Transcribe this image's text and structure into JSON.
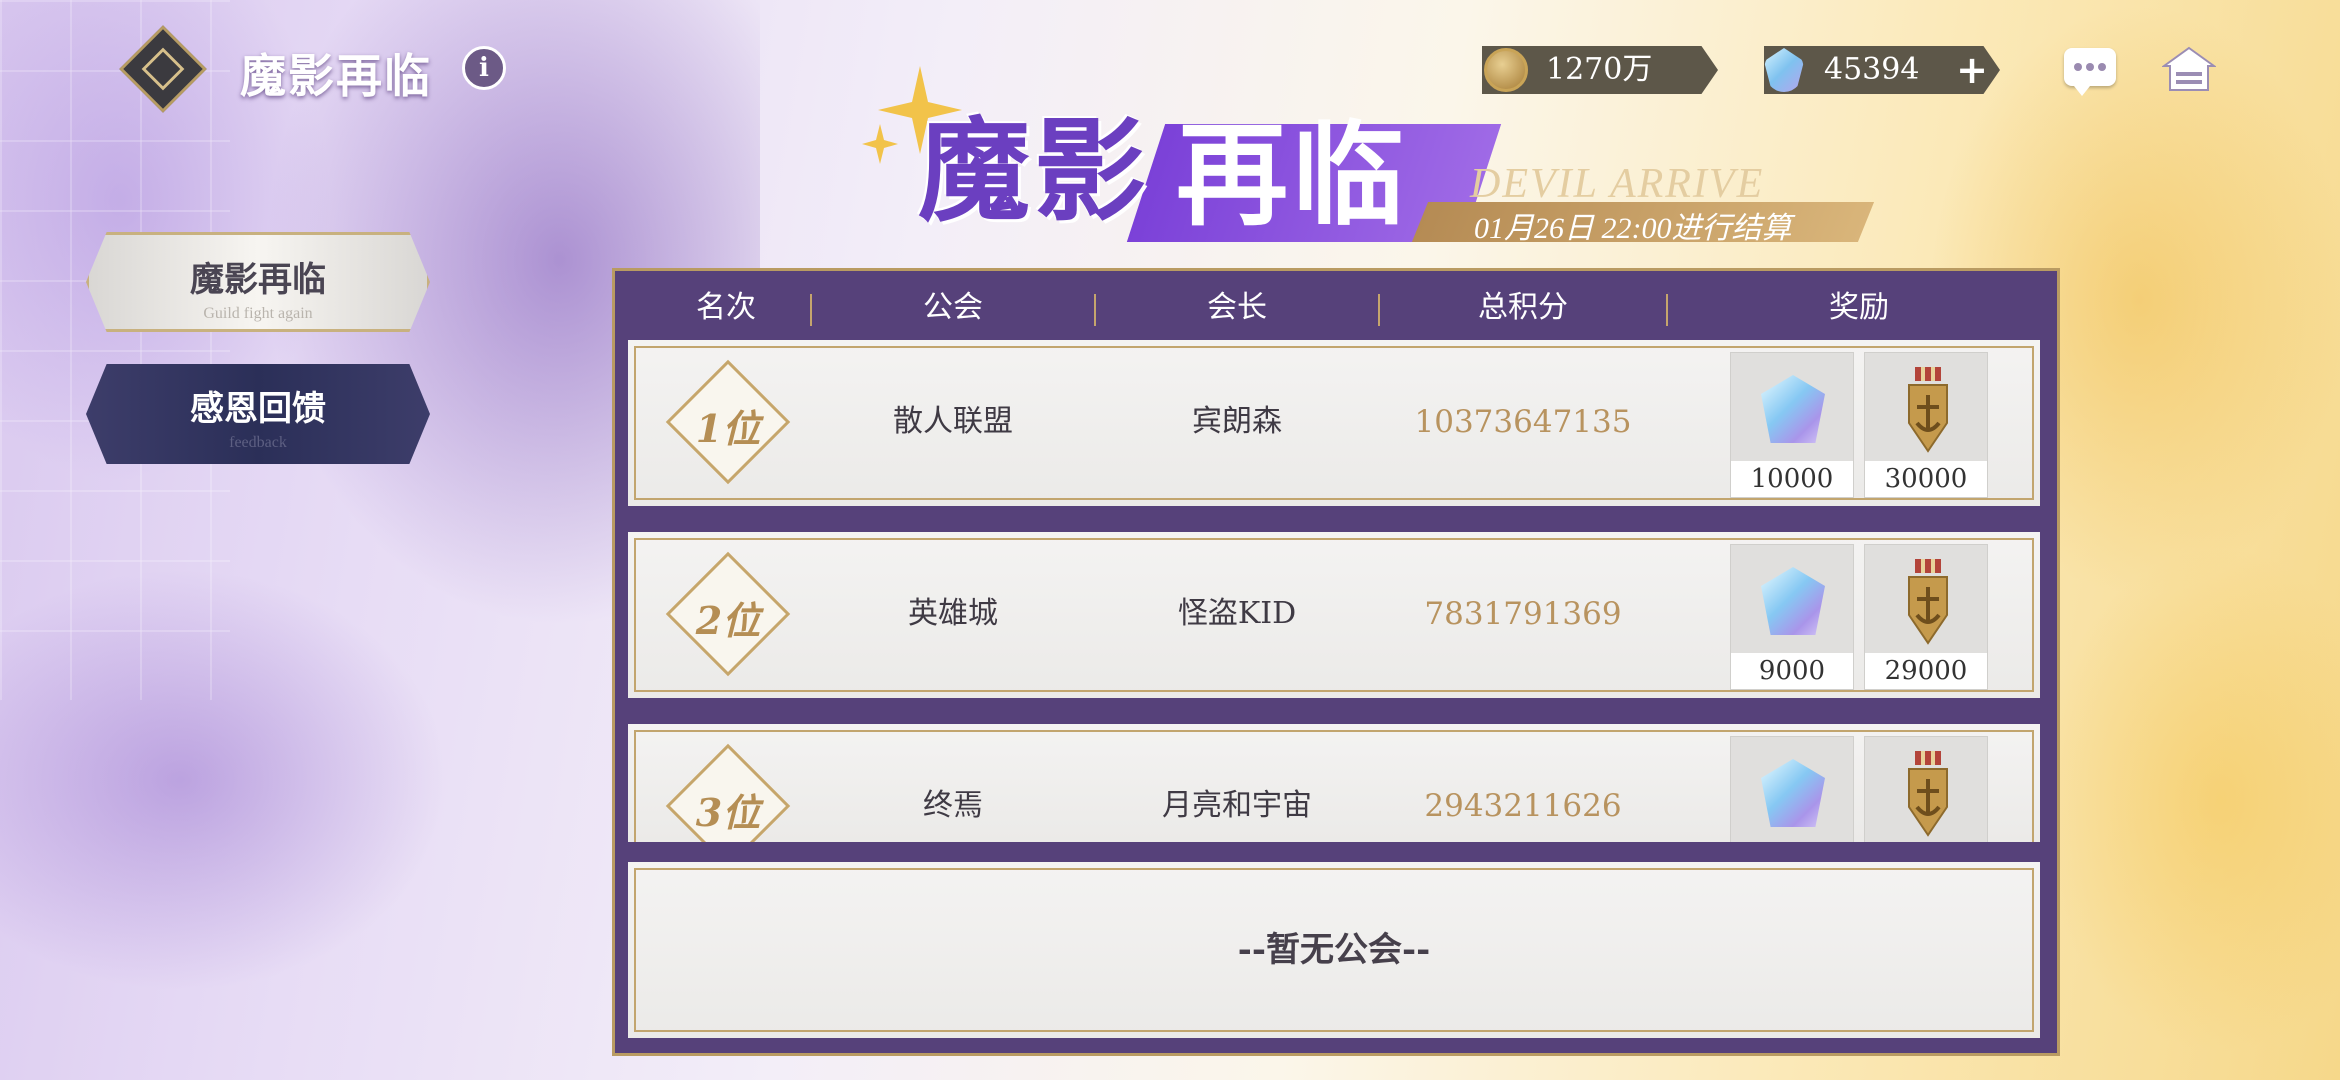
{
  "header": {
    "title": "魔影再临",
    "info_label": "i",
    "gold_amount": "1270万",
    "gem_amount": "45394",
    "plus_label": "+"
  },
  "banner": {
    "title_left": "魔影",
    "title_right": "再临",
    "english": "DEVIL ARRIVE",
    "settle_time": "01月26日 22:00进行结算"
  },
  "side_menu": {
    "items": [
      {
        "label": "魔影再临",
        "sub": "Guild fight again"
      },
      {
        "label": "感恩回馈",
        "sub": "feedback"
      }
    ]
  },
  "table": {
    "columns": [
      "名次",
      "公会",
      "会长",
      "总积分",
      "奖励"
    ],
    "rows": [
      {
        "rank": "1位",
        "guild": "散人联盟",
        "leader": "宾朗森",
        "score": "10373647135",
        "reward_gem": "10000",
        "reward_medal": "30000"
      },
      {
        "rank": "2位",
        "guild": "英雄城",
        "leader": "怪盗KID",
        "score": "7831791369",
        "reward_gem": "9000",
        "reward_medal": "29000"
      },
      {
        "rank": "3位",
        "guild": "终焉",
        "leader": "月亮和宇宙",
        "score": "2943211626",
        "reward_gem": "",
        "reward_medal": ""
      }
    ],
    "empty_text": "--暂无公会--"
  },
  "icons": {
    "logo": "guild-emblem-icon",
    "coin": "coin-icon",
    "gem": "gem-icon",
    "chat": "chat-icon",
    "home": "home-icon",
    "medal": "medal-icon"
  },
  "colors": {
    "panel_purple": "#56417a",
    "gold_accent": "#b99b62",
    "banner_purple": "#6b3fc0",
    "score_gold": "#b8935f"
  }
}
